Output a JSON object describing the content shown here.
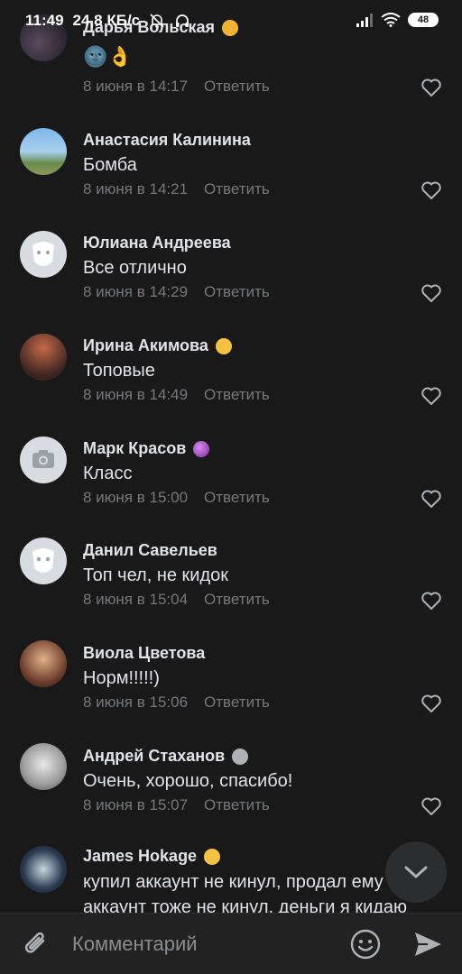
{
  "status_bar": {
    "time": "11:49",
    "speed": "24,8 КБ/с",
    "battery": "48"
  },
  "comments": [
    {
      "name": "Дарья Вольская",
      "text": "",
      "date": "8 июня в 14:17",
      "reply": "Ответить",
      "emoji_text": "🌚👌"
    },
    {
      "name": "Анастасия Калинина",
      "text": "Бомба",
      "date": "8 июня в 14:21",
      "reply": "Ответить"
    },
    {
      "name": "Юлиана Андреева",
      "text": "Все отлично",
      "date": "8 июня в 14:29",
      "reply": "Ответить"
    },
    {
      "name": "Ирина Акимова",
      "text": "Топовые",
      "date": "8 июня в 14:49",
      "reply": "Ответить"
    },
    {
      "name": "Марк Красов",
      "text": "Класс",
      "date": "8 июня в 15:00",
      "reply": "Ответить"
    },
    {
      "name": "Данил Савельев",
      "text": "Топ чел, не кидок",
      "date": "8 июня в 15:04",
      "reply": "Ответить"
    },
    {
      "name": "Виола Цветова",
      "text": "Норм!!!!!)",
      "date": "8 июня в 15:06",
      "reply": "Ответить"
    },
    {
      "name": "Андрей Стаханов",
      "text": "Очень, хорошо, спасибо!",
      "date": "8 июня в 15:07",
      "reply": "Ответить"
    },
    {
      "name": "James Hokage",
      "text": "купил аккаунт не кинул, продал ему",
      "text2": "аккаунт тоже не кинул, деньги я кидаю"
    }
  ],
  "composer": {
    "placeholder": "Комментарий"
  },
  "icons": {
    "attach": "paperclip-icon",
    "emoji": "smile-icon",
    "send": "send-icon",
    "scroll": "chevron-down-icon",
    "like": "heart-icon"
  },
  "colors": {
    "background": "#19191a",
    "secondary_text": "#76787a",
    "primary_text": "#e1e3e6"
  }
}
